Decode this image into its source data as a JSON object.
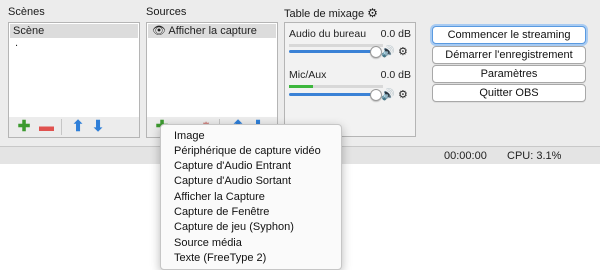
{
  "scenes": {
    "title": "Scènes",
    "items": [
      "Scène",
      "."
    ]
  },
  "sources": {
    "title": "Sources",
    "items": [
      "Afficher la capture"
    ],
    "visibility_icon": "eye-icon"
  },
  "mixer": {
    "title": "Table de mixage",
    "title_icon": "gear-icon",
    "channels": [
      {
        "name": "Audio du bureau",
        "db": "0.0 dB",
        "level": 1.0,
        "meter_level": 0.0
      },
      {
        "name": "Mic/Aux",
        "db": "0.0 dB",
        "level": 1.0,
        "meter_level": 0.25
      }
    ]
  },
  "controls": {
    "start_streaming": "Commencer le streaming",
    "start_recording": "Démarrer l'enregistrement",
    "settings": "Paramètres",
    "quit": "Quitter OBS"
  },
  "status": {
    "time": "00:00:00",
    "cpu": "CPU: 3.1%"
  },
  "add_source_menu": {
    "items": [
      "Image",
      "Périphérique de capture vidéo",
      "Capture d'Audio Entrant",
      "Capture d'Audio Sortant",
      "Afficher la Capture",
      "Capture de Fenêtre",
      "Capture de jeu (Syphon)",
      "Source média",
      "Texte (FreeType 2)"
    ]
  },
  "colors": {
    "add": "#3c9a2f",
    "remove": "#e0524f",
    "arrow": "#2f7fd8",
    "slider": "#3b82d6",
    "meter": "#3db73d",
    "primary_focus": "#a8cbf2"
  }
}
